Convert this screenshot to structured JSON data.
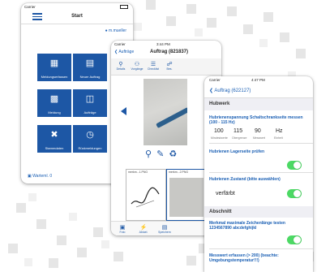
{
  "colors": {
    "accent": "#1d57a5",
    "toggle_on": "#4cd964",
    "section_bg": "#efeff4"
  },
  "phone1": {
    "carrier": "Carrier",
    "title": "Start",
    "user": "m.mueller",
    "tiles": [
      {
        "label": "Meldungserfassen",
        "icon": "grid-icon"
      },
      {
        "label": "Neuer Auftrag",
        "icon": "book-icon"
      },
      {
        "label": "Meldung",
        "icon": "document-icon"
      },
      {
        "label": "Aufträge",
        "icon": "book-open-icon"
      },
      {
        "label": "Stammdaten",
        "icon": "tools-icon"
      },
      {
        "label": "Rückmeldungen",
        "icon": "clock-icon"
      }
    ],
    "queue_label": "Warteml. 0"
  },
  "phone2": {
    "carrier": "Carrier",
    "time": "3:44 PM",
    "back_label": "Aufträge",
    "title": "Auftrag (821837)",
    "tabs": [
      "Details",
      "Vorgänge",
      "Checklist",
      "Bes."
    ],
    "thumbs": [
      "merkm...1.PNG",
      "merkm...2.PNG"
    ],
    "bottom": [
      "Foto",
      "Aktuel.",
      "Speichern"
    ]
  },
  "phone3": {
    "carrier": "Carrier",
    "time": "4:47 PM",
    "back_label": "Auftrag (622127)",
    "section1": "Hubwerk",
    "item1_label": "Hubrienenspannung Schaltschrankseite messen (100 - 115 Hz)",
    "values": [
      "100",
      "115",
      "90",
      "Hz"
    ],
    "value_subs": [
      "Mindestwerte",
      "Obergrenze",
      "Messwert",
      "Einheit"
    ],
    "item2_label": "Hubrienen Lagerseite prüfen",
    "item3_label": "Hubrienen Zustand (bitte auswählen)",
    "item3_value": "verfärbt",
    "section2": "Abschnitt",
    "item4_label": "Merkmal maximale Zeichenlänge testen 1234567890 abcdefghijkl",
    "item5_label": "Messwert erfassen (> 200) (beachte: Umgebungstemperatur!!!)"
  }
}
